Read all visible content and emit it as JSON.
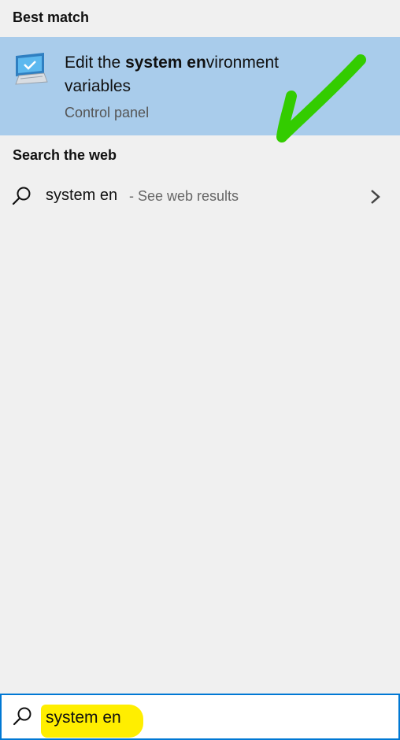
{
  "sections": {
    "best_match": "Best match",
    "search_web": "Search the web"
  },
  "best_match_item": {
    "title_prefix": "Edit the ",
    "title_bold": "system en",
    "title_suffix": "vironment variables",
    "subtitle": "Control panel",
    "icon": "monitor-checkmark-icon"
  },
  "web_result": {
    "query": "system en",
    "hint": "- See web results",
    "icon": "search-icon",
    "action_icon": "chevron-right-icon"
  },
  "search_box": {
    "value": "system en",
    "icon": "search-icon"
  },
  "colors": {
    "selection_bg": "#a9cceb",
    "panel_bg": "#f0f0f0",
    "accent_border": "#0078d4",
    "highlighter": "#ffee00",
    "annotation_check": "#33cc00"
  }
}
